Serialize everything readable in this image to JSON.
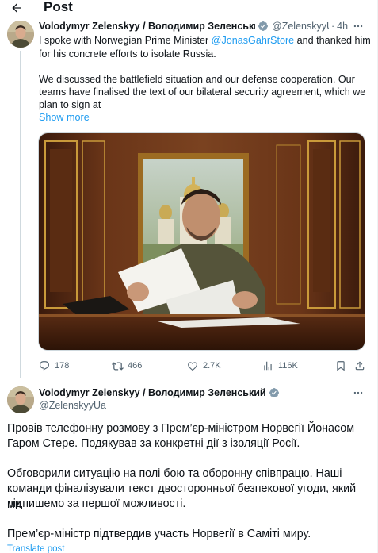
{
  "header": {
    "title": "Post"
  },
  "post1": {
    "author_name": "Volodymyr Zelenskyy / Володимир Зеленський",
    "handle": "@ZelenskyyUa",
    "time": "4h",
    "text": {
      "l1_pre": "I spoke with Norwegian Prime Minister ",
      "l1_mention": "@JonasGahrStore",
      "l1_post": " and thanked him",
      "l2": "for his concrete efforts to isolate Russia.",
      "l3": "We discussed the battlefield situation and our defense cooperation. Our",
      "l4": "teams have finalised the text of our bilateral security agreement, which we",
      "l5": "plan to sign at"
    },
    "show_more": "Show more",
    "stats": {
      "replies": "178",
      "reposts": "466",
      "likes": "2.7K",
      "views": "116K"
    }
  },
  "post2": {
    "author_name": "Volodymyr Zelenskyy / Володимир Зеленський",
    "handle": "@ZelenskyyUa",
    "lines": [
      "Провів телефонну розмову з Прем’єр-міністром Норвегії Йонасом",
      "Гаром Стере. Подякував за конкретні дії з ізоляції Росії.",
      "Обговорили ситуацію на полі бою та оборонну співпрацю. Наші",
      "команди фіналізували текст двосторонньої безпекової угоди, який ми",
      "підпишемо за першої можливості.",
      "Прем’єр-міністр підтвердив участь Норвегії в Саміті миру."
    ],
    "translate": "Translate post"
  },
  "colors": {
    "accent": "#1d9bf0",
    "text": "#0f1419",
    "muted": "#536471",
    "border": "#cfd9de"
  },
  "icons": [
    "back-arrow-icon",
    "verified-badge-icon",
    "more-icon",
    "reply-icon",
    "repost-icon",
    "like-icon",
    "views-icon",
    "bookmark-icon",
    "share-icon"
  ]
}
